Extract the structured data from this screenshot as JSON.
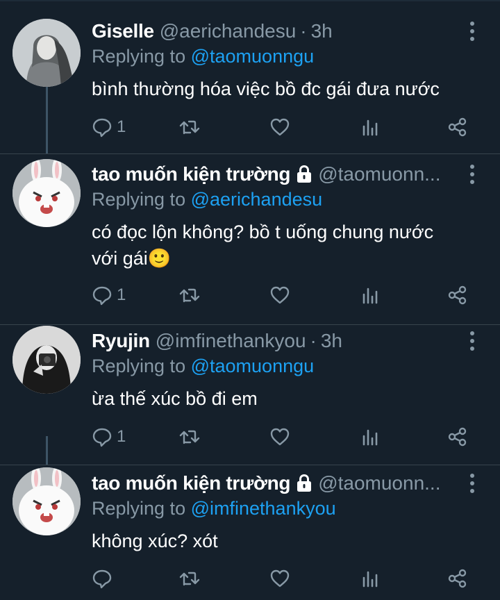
{
  "colors": {
    "background": "#15202b",
    "muted": "#8899a6",
    "accent": "#1da1f2",
    "text": "#ffffff"
  },
  "replying_label": "Replying to",
  "tweets": [
    {
      "name": "Giselle",
      "handle": "@aerichandesu",
      "time": "3h",
      "reply_to": "@taomuonngu",
      "text": "bình thường hóa việc bồ đc gái đưa nước",
      "reply_count": "1",
      "locked": false
    },
    {
      "name": "tao muốn kiện trường",
      "handle": "@taomuonn...",
      "time": "",
      "reply_to": "@aerichandesu",
      "text": "có đọc lộn không? bồ t uống chung nước với gái🙂",
      "reply_count": "1",
      "locked": true
    },
    {
      "name": "Ryujin",
      "handle": "@imfinethankyou",
      "time": "3h",
      "reply_to": "@taomuonngu",
      "text": "ừa thế xúc bồ đi em",
      "reply_count": "1",
      "locked": false
    },
    {
      "name": "tao muốn kiện trường",
      "handle": "@taomuonn...",
      "time": "",
      "reply_to": "@imfinethankyou",
      "text": "không xúc? xót",
      "reply_count": "",
      "locked": true
    }
  ]
}
